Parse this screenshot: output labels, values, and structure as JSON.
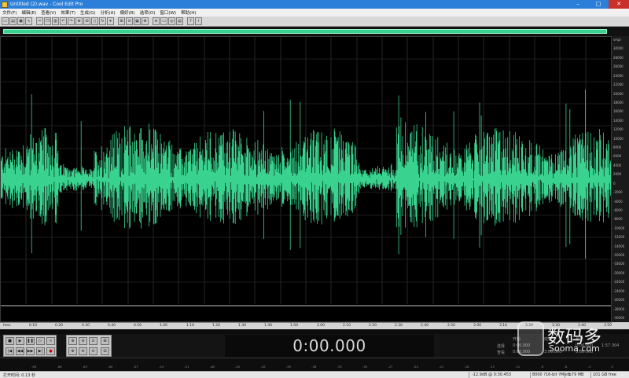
{
  "window": {
    "title": "Untitled (2).wav - Cool Edit Pro",
    "controls": {
      "minimize": "–",
      "maximize": "□",
      "close": "✕"
    }
  },
  "menu": [
    "文件(F)",
    "编辑(E)",
    "查看(V)",
    "效果(T)",
    "生成(G)",
    "分析(A)",
    "偏好(R)",
    "选项(O)",
    "窗口(W)",
    "帮助(H)"
  ],
  "toolbar": {
    "buttons": [
      "new-icon",
      "open-icon",
      "save-icon",
      "waveform-icon",
      "sep",
      "cut-icon",
      "copy-icon",
      "paste-icon",
      "undo-icon",
      "redo-icon",
      "mix-icon",
      "trim-icon",
      "silence-icon",
      "loop-icon",
      "marker-icon",
      "sep",
      "snap-icon",
      "zoom-icon",
      "spectral-icon",
      "settings-icon",
      "sep",
      "multitrack-icon",
      "edit-view-icon",
      "cd-icon",
      "script-icon",
      "sep",
      "help-icon",
      "info-icon"
    ]
  },
  "overview": {
    "visible_fraction": 0.97,
    "color": "#39d38f"
  },
  "waveform": {
    "color": "#39d38f",
    "background": "#000000",
    "center_line_color": "#3a3a3a",
    "grid": true
  },
  "y_axis": {
    "unit": "smpl",
    "labels": [
      "smpl",
      "30000",
      "28000",
      "26000",
      "24000",
      "22000",
      "20000",
      "18000",
      "16000",
      "14000",
      "12000",
      "10000",
      "8000",
      "6000",
      "4000",
      "2000",
      "0",
      "-2000",
      "-4000",
      "-6000",
      "-8000",
      "-10000",
      "-12000",
      "-14000",
      "-16000",
      "-18000",
      "-20000",
      "-22000",
      "-24000",
      "-26000",
      "-28000",
      "-30000"
    ]
  },
  "ruler": {
    "labels": [
      "hms",
      "0.10",
      "0.20",
      "0.30",
      "0.40",
      "0.50",
      "1.00",
      "1.10",
      "1.20",
      "1.30",
      "1.40",
      "1.50",
      "2.00",
      "2.10",
      "2.20",
      "2.30",
      "2.40",
      "2.50",
      "3.00",
      "3.10",
      "3.20",
      "3.30",
      "3.40",
      "3.50"
    ]
  },
  "transport": {
    "row1": [
      "stop-icon",
      "play-icon",
      "pause-icon",
      "play-to-end-icon",
      "loop-icon"
    ],
    "row2": [
      "go-start-icon",
      "rewind-icon",
      "fast-forward-icon",
      "go-end-icon",
      "record-icon"
    ],
    "zoom_row1": [
      "zoom-in-h-icon",
      "zoom-out-h-icon",
      "zoom-full-icon"
    ],
    "zoom_row2": [
      "zoom-in-v-icon",
      "zoom-out-v-icon",
      "zoom-sel-icon"
    ],
    "zoom_extra": [
      "zoom-left-icon",
      "zoom-right-icon"
    ],
    "time": "0:00.000"
  },
  "selection_panel": {
    "header": [
      "开始",
      "结束",
      "长度"
    ],
    "sel_label": "选择",
    "view_label": "查看",
    "sel_values": [
      "0:00.000",
      "",
      "0:00.000"
    ],
    "view_values": [
      "0:00.000",
      "3:00.000",
      "3:00.000"
    ],
    "extra": "1:57.304"
  },
  "watermark": {
    "brand": "数码多",
    "domain": "Sooma.com"
  },
  "meter": {
    "labels": [
      "-69",
      "-66",
      "-63",
      "-60",
      "-57",
      "-54",
      "-51",
      "-48",
      "-45",
      "-42",
      "-39",
      "-36",
      "-33",
      "-30",
      "-27",
      "-24",
      "-21",
      "-18",
      "-15",
      "-12",
      "-9",
      "-6",
      "-3",
      "0"
    ]
  },
  "status": {
    "left": "打开时间: 0.13 秒",
    "level": "-12.9dB @ 0:30.453",
    "format": "8000 ?16-bit ?Mono",
    "size": "3.79 MB",
    "free": "101 GB free"
  }
}
